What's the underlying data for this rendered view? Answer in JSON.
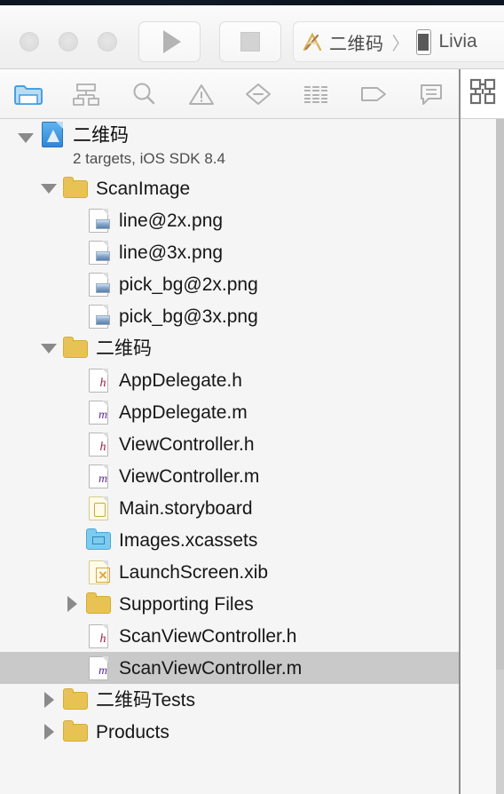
{
  "window": {
    "titlebar": {
      "traffic_lights": [
        "close-button",
        "minimize-button",
        "zoom-button"
      ],
      "run_label": "Run",
      "stop_label": "Stop",
      "scheme_name": "二维码",
      "scheme_separator": "〉",
      "destination_name": "Livia"
    }
  },
  "navigator": {
    "tabs": [
      {
        "name": "project-navigator",
        "icon": "folder-icon",
        "selected": true
      },
      {
        "name": "symbol-navigator",
        "icon": "hierarchy-icon",
        "selected": false
      },
      {
        "name": "find-navigator",
        "icon": "search-icon",
        "selected": false
      },
      {
        "name": "issue-navigator",
        "icon": "warning-triangle-icon",
        "selected": false
      },
      {
        "name": "test-navigator",
        "icon": "diamond-minus-icon",
        "selected": false
      },
      {
        "name": "debug-navigator",
        "icon": "report-lines-icon",
        "selected": false
      },
      {
        "name": "breakpoint-navigator",
        "icon": "tag-icon",
        "selected": false
      },
      {
        "name": "log-navigator",
        "icon": "comment-bubble-icon",
        "selected": false
      }
    ],
    "editor_tab_icon": "qr-code-icon"
  },
  "tree": [
    {
      "id": "project",
      "label": "二维码",
      "sub": "2 targets, iOS SDK 8.4",
      "icon": "xcode-project-icon",
      "indent": 0,
      "disclosure": "open",
      "selected": false
    },
    {
      "id": "scanimage",
      "label": "ScanImage",
      "icon": "folder-yellow-icon",
      "indent": 1,
      "disclosure": "open",
      "selected": false
    },
    {
      "id": "line2x",
      "label": "line@2x.png",
      "icon": "image-file-icon",
      "indent": 2,
      "disclosure": "none",
      "selected": false
    },
    {
      "id": "line3x",
      "label": "line@3x.png",
      "icon": "image-file-icon",
      "indent": 2,
      "disclosure": "none",
      "selected": false
    },
    {
      "id": "pickbg2x",
      "label": "pick_bg@2x.png",
      "icon": "image-file-icon",
      "indent": 2,
      "disclosure": "none",
      "selected": false
    },
    {
      "id": "pickbg3x",
      "label": "pick_bg@3x.png",
      "icon": "image-file-icon",
      "indent": 2,
      "disclosure": "none",
      "selected": false
    },
    {
      "id": "erweima-group",
      "label": "二维码",
      "icon": "folder-yellow-icon",
      "indent": 1,
      "disclosure": "open",
      "selected": false
    },
    {
      "id": "appdelegate-h",
      "label": "AppDelegate.h",
      "icon": "header-file-icon",
      "indent": 2,
      "disclosure": "none",
      "selected": false
    },
    {
      "id": "appdelegate-m",
      "label": "AppDelegate.m",
      "icon": "source-file-icon",
      "indent": 2,
      "disclosure": "none",
      "selected": false
    },
    {
      "id": "viewcontroller-h",
      "label": "ViewController.h",
      "icon": "header-file-icon",
      "indent": 2,
      "disclosure": "none",
      "selected": false
    },
    {
      "id": "viewcontroller-m",
      "label": "ViewController.m",
      "icon": "source-file-icon",
      "indent": 2,
      "disclosure": "none",
      "selected": false
    },
    {
      "id": "main-storyboard",
      "label": "Main.storyboard",
      "icon": "storyboard-file-icon",
      "indent": 2,
      "disclosure": "none",
      "selected": false
    },
    {
      "id": "images-xcassets",
      "label": "Images.xcassets",
      "icon": "asset-catalog-icon",
      "indent": 2,
      "disclosure": "none",
      "selected": false
    },
    {
      "id": "launchscreen-xib",
      "label": "LaunchScreen.xib",
      "icon": "xib-file-icon",
      "indent": 2,
      "disclosure": "none",
      "selected": false
    },
    {
      "id": "supporting-files",
      "label": "Supporting Files",
      "icon": "folder-yellow-icon",
      "indent": 2,
      "disclosure": "closed",
      "selected": false
    },
    {
      "id": "scanvc-h",
      "label": "ScanViewController.h",
      "icon": "header-file-icon",
      "indent": 2,
      "disclosure": "none",
      "selected": false
    },
    {
      "id": "scanvc-m",
      "label": "ScanViewController.m",
      "icon": "source-file-icon",
      "indent": 2,
      "disclosure": "none",
      "selected": true
    },
    {
      "id": "erweima-tests",
      "label": "二维码Tests",
      "icon": "folder-yellow-icon",
      "indent": 1,
      "disclosure": "closed",
      "selected": false
    },
    {
      "id": "products",
      "label": "Products",
      "icon": "folder-yellow-icon",
      "indent": 1,
      "disclosure": "closed",
      "selected": false
    }
  ],
  "colors": {
    "accent_blue": "#4a9fe0",
    "folder_yellow": "#e8c354",
    "selection_gray": "#c9c9c9",
    "navigator_bg": "#f5f5f5",
    "header_letter_h": "#9b1b40",
    "header_letter_m": "#5d2a96"
  }
}
